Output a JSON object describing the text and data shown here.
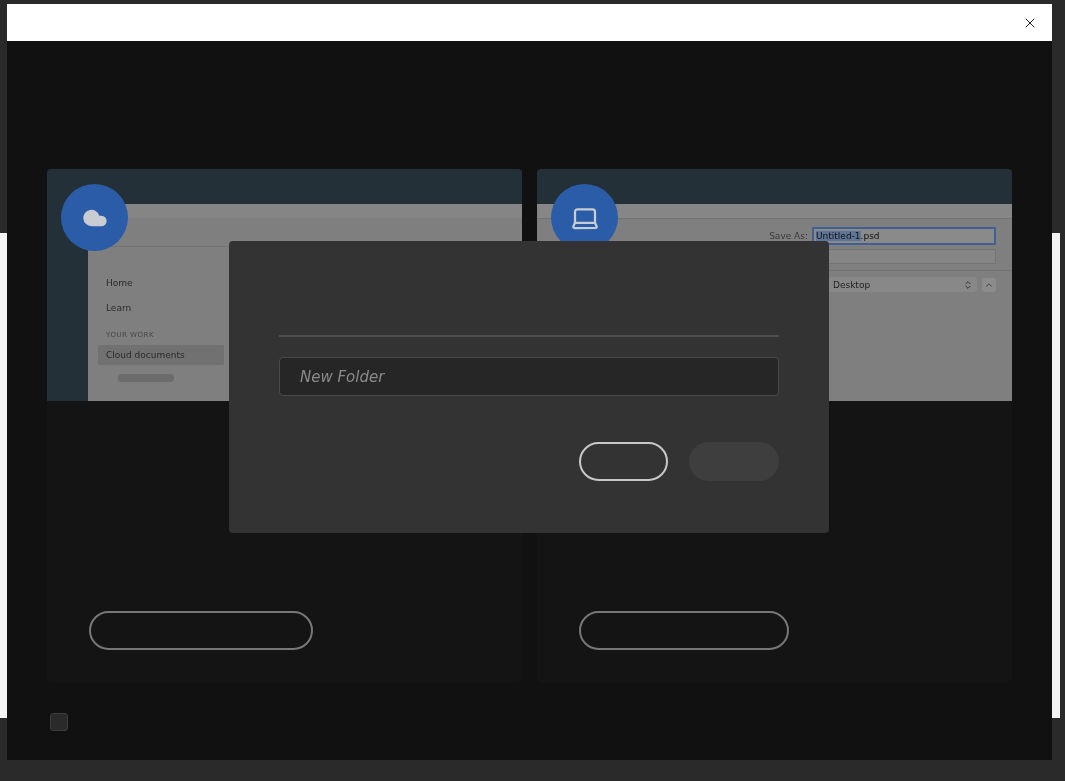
{
  "cloud_card": {
    "nav_items": [
      {
        "label": "Home",
        "selected": false
      },
      {
        "label": "Learn",
        "selected": false
      }
    ],
    "section_title": "YOUR WORK",
    "section_items": [
      {
        "label": "Cloud documents",
        "selected": true
      }
    ]
  },
  "computer_card": {
    "save_as_label": "Save As:",
    "file_name_parts": [
      {
        "text": "Untitled-1",
        "selected": true
      },
      {
        "text": ".psd",
        "selected": false
      }
    ],
    "location": "Desktop"
  },
  "new_folder_dialog": {
    "placeholder": "New Folder"
  },
  "dont_show_again": {
    "checked": false
  }
}
